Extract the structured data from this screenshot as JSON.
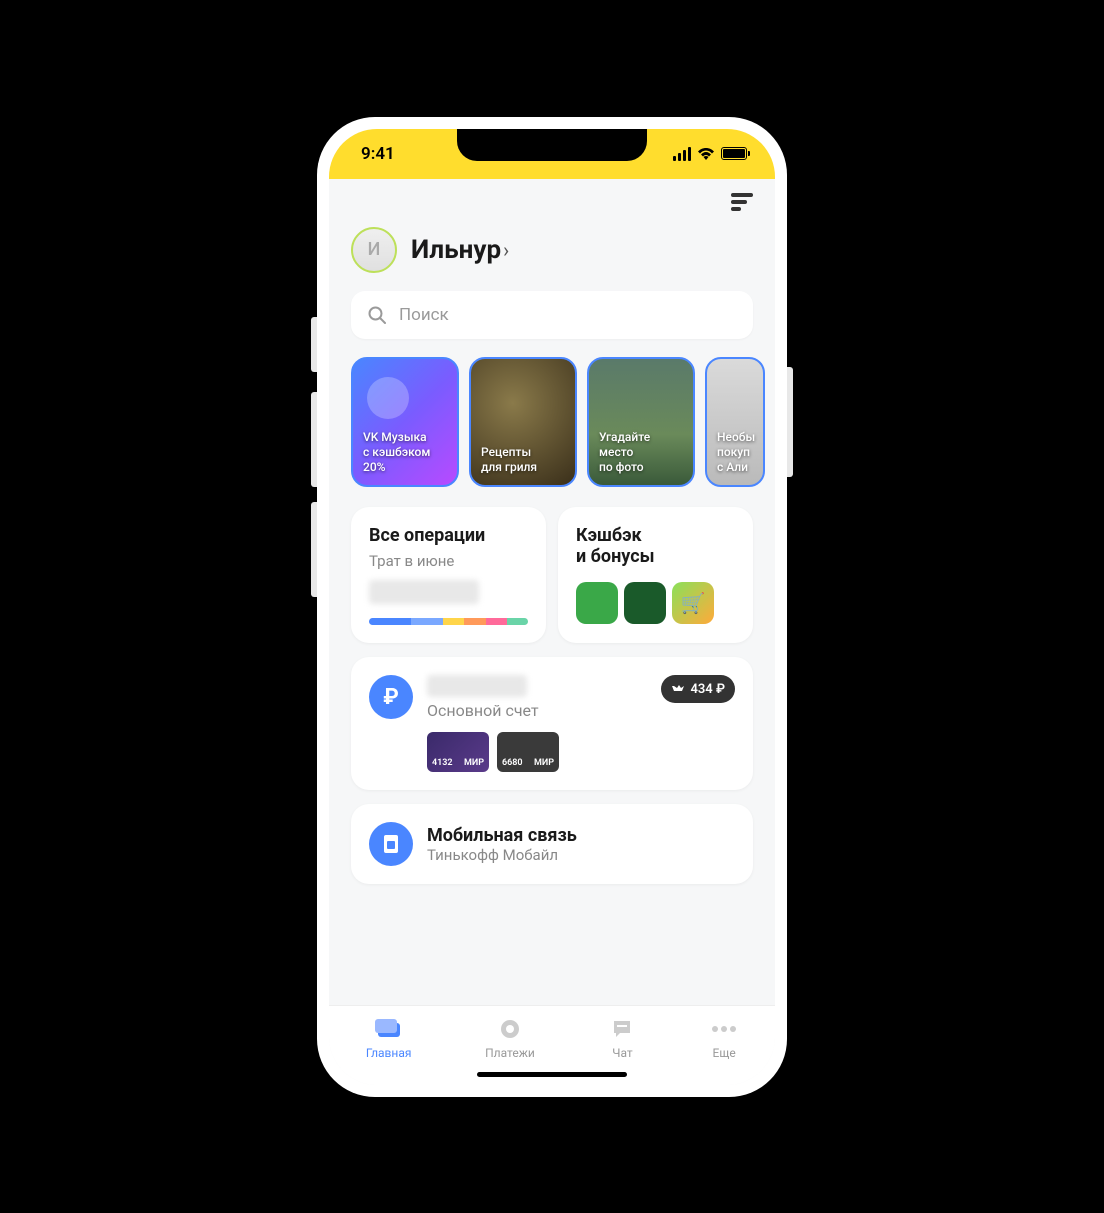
{
  "status": {
    "time": "9:41"
  },
  "profile": {
    "initial": "И",
    "name": "Ильнур"
  },
  "search": {
    "placeholder": "Поиск"
  },
  "stories": [
    {
      "text": "VK Музыка\nс кэшбэком\n20%"
    },
    {
      "text": "Рецепты\nдля гриля"
    },
    {
      "text": "Угадайте\nместо\nпо фото"
    },
    {
      "text": "Необы\nпокуп\nс Али"
    }
  ],
  "operations": {
    "title": "Все операции",
    "subtitle": "Трат в июне"
  },
  "cashback": {
    "title": "Кэшбэк\nи бонусы"
  },
  "account": {
    "label": "Основной счет",
    "badge": "434 ₽",
    "cards": [
      {
        "last4": "4132",
        "system": "МИР"
      },
      {
        "last4": "6680",
        "system": "МИР"
      }
    ]
  },
  "mobile": {
    "title": "Мобильная связь",
    "subtitle": "Тинькофф Мобайл"
  },
  "tabs": [
    {
      "label": "Главная"
    },
    {
      "label": "Платежи"
    },
    {
      "label": "Чат"
    },
    {
      "label": "Еще"
    }
  ]
}
